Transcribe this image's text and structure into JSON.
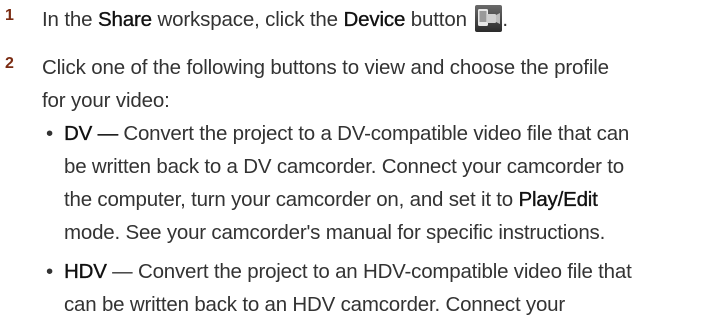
{
  "step1": {
    "number": "1",
    "prefix": "In the ",
    "workspace": "Share",
    "middle": " workspace, click the ",
    "button_name": "Device",
    "suffix": " button",
    "end": ".",
    "icon": "device-camcorder-icon"
  },
  "step2": {
    "number": "2",
    "line1": "Click one of the following buttons to view and choose the profile",
    "line2": "for your video:"
  },
  "bullets": {
    "dv": {
      "dot": "•",
      "label": "DV —",
      "line1": " Convert the project to a DV-compatible video file that can",
      "line2": "be written back to a DV camcorder. Connect your camcorder to",
      "line3": "the computer, turn your camcorder on, and set it to ",
      "mode": "Play/Edit",
      "line4": "mode. See your camcorder's manual for specific instructions."
    },
    "hdv": {
      "dot": "•",
      "label": "HDV",
      "line1": " — Convert the project to an HDV-compatible video file that",
      "line2": "can be written back to an HDV camcorder. Connect your"
    }
  }
}
